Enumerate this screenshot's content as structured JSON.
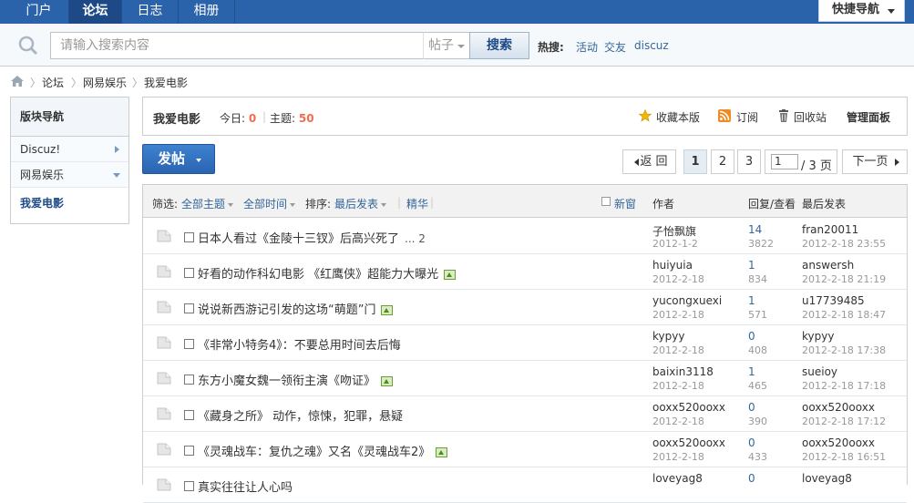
{
  "nav": {
    "items": [
      {
        "label": "门户"
      },
      {
        "label": "论坛"
      },
      {
        "label": "日志"
      },
      {
        "label": "相册"
      }
    ],
    "quick_nav": "快捷导航"
  },
  "search": {
    "placeholder": "请输入搜索内容",
    "type": "帖子",
    "button": "搜索",
    "hot_label": "热搜:",
    "hot": [
      "活动",
      "交友",
      "discuz"
    ]
  },
  "breadcrumb": [
    "论坛",
    "网易娱乐",
    "我爱电影"
  ],
  "sidebar": {
    "title": "版块导航",
    "items": [
      {
        "label": "Discuz!"
      },
      {
        "label": "网易娱乐"
      },
      {
        "label": "我爱电影"
      }
    ]
  },
  "forum": {
    "title": "我爱电影",
    "today_label": "今日:",
    "today": "0",
    "topics_label": "主题:",
    "topics": "50",
    "favorite": "收藏本版",
    "subscribe": "订阅",
    "recycle": "回收站",
    "admin": "管理面板"
  },
  "post_button": "发帖",
  "pager": {
    "back": "返 回",
    "pages": [
      "1",
      "2",
      "3"
    ],
    "input": "1",
    "total": "/ 3 页",
    "next": "下一页"
  },
  "list_header": {
    "filter_label": "筛选:",
    "all_topics": "全部主题",
    "all_time": "全部时间",
    "sort_label": "排序:",
    "sort_value": "最后发表",
    "digest": "精华",
    "new_window": "新窗",
    "col_author": "作者",
    "col_replies": "回复/查看",
    "col_last": "最后发表"
  },
  "threads": [
    {
      "title": "日本人看过《金陵十三钗》后高兴死了",
      "extra": "... 2",
      "has_image": false,
      "author": "子怡飘旗",
      "date": "2012-1-2",
      "replies": "14",
      "views": "3822",
      "last_user": "fran20011",
      "last_date": "2012-2-18 23:55"
    },
    {
      "title": "好看的动作科幻电影 《红鹰侠》超能力大曝光",
      "extra": "",
      "has_image": true,
      "author": "huiyuia",
      "date": "2012-2-18",
      "replies": "1",
      "views": "834",
      "last_user": "answersh",
      "last_date": "2012-2-18 21:19"
    },
    {
      "title": "说说新西游记引发的这场“萌题”门",
      "extra": "",
      "has_image": true,
      "author": "yucongxuexi",
      "date": "2012-2-18",
      "replies": "1",
      "views": "571",
      "last_user": "u17739485",
      "last_date": "2012-2-18 18:47"
    },
    {
      "title": "《非常小特务4》：不要总用时间去后悔",
      "extra": "",
      "has_image": false,
      "author": "kypyy",
      "date": "2012-2-18",
      "replies": "0",
      "views": "408",
      "last_user": "kypyy",
      "last_date": "2012-2-18 17:38"
    },
    {
      "title": "东方小魔女魏一领衔主演《吻证》",
      "extra": "",
      "has_image": true,
      "author": "baixin3118",
      "date": "2012-2-18",
      "replies": "1",
      "views": "465",
      "last_user": "sueioy",
      "last_date": "2012-2-18 17:18"
    },
    {
      "title": "《藏身之所》 动作，惊悚，犯罪，悬疑",
      "extra": "",
      "has_image": false,
      "author": "ooxx520ooxx",
      "date": "2012-2-18",
      "replies": "0",
      "views": "390",
      "last_user": "ooxx520ooxx",
      "last_date": "2012-2-18 17:12"
    },
    {
      "title": "《灵魂战车：复仇之魂》又名《灵魂战车2》",
      "extra": "",
      "has_image": true,
      "author": "ooxx520ooxx",
      "date": "2012-2-18",
      "replies": "0",
      "views": "433",
      "last_user": "ooxx520ooxx",
      "last_date": "2012-2-18 16:51"
    },
    {
      "title": "真实往往让人心吗",
      "extra": "",
      "has_image": false,
      "author": "loveyag8",
      "date": "",
      "replies": "0",
      "views": "",
      "last_user": "loveyag8",
      "last_date": ""
    }
  ],
  "colors": {
    "nav_bg": "#2b63aa",
    "accent_blue": "#336699",
    "stat_orange": "#f26c4f"
  }
}
